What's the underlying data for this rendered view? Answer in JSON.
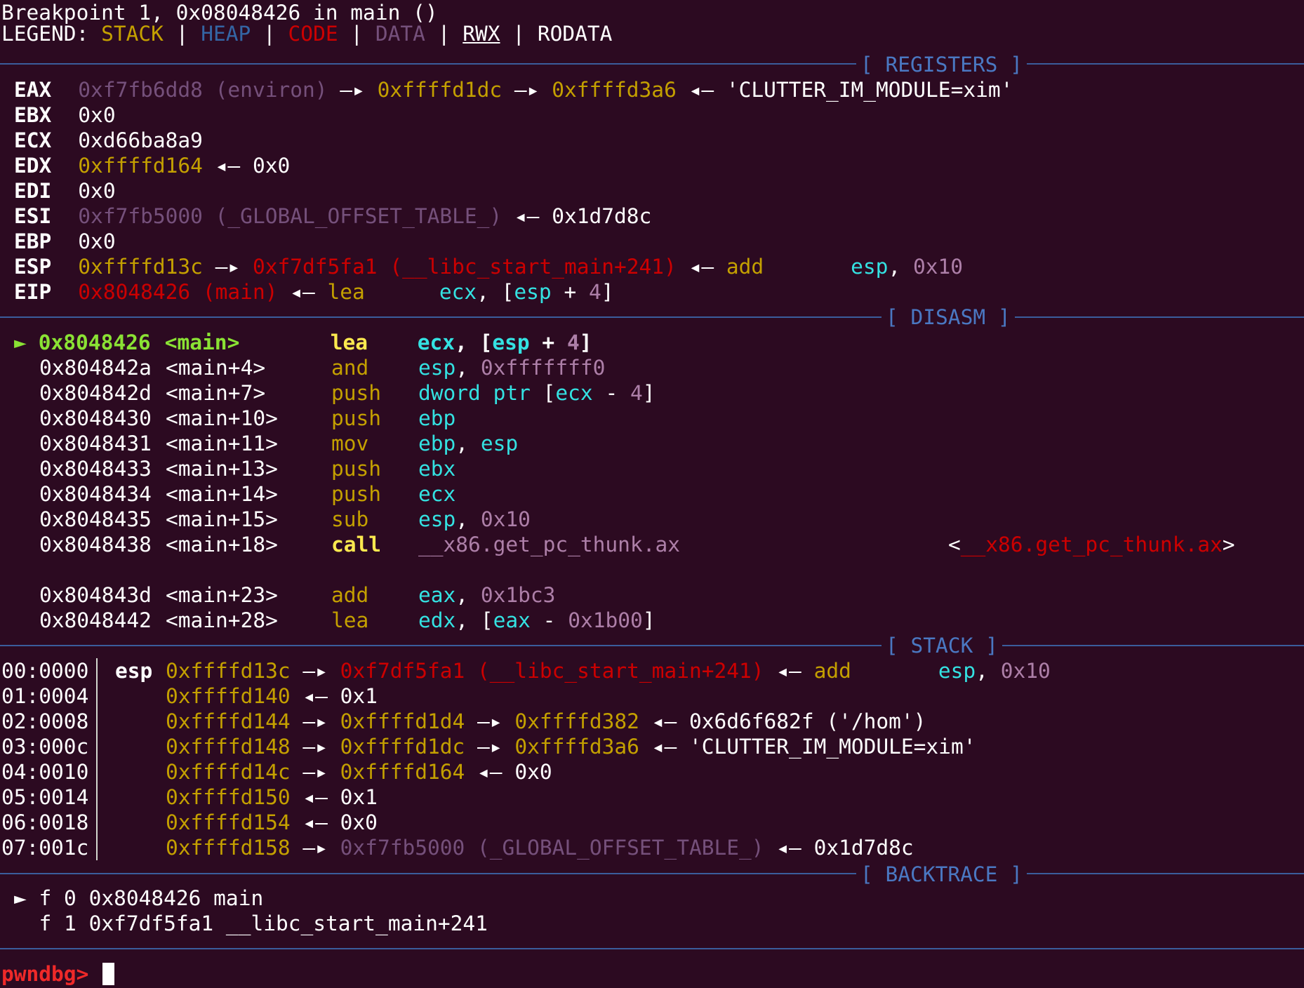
{
  "header": {
    "breakpoint_line": "Breakpoint 1, 0x08048426 in main ()",
    "legend_label": "LEGEND: ",
    "legend": {
      "stack": "STACK",
      "heap": "HEAP",
      "code": "CODE",
      "data": "DATA",
      "rwx": "RWX",
      "rodata": "RODATA",
      "sep": " | "
    }
  },
  "sections": {
    "registers": "[ REGISTERS ]",
    "disasm": "[ DISASM ]",
    "stack": "[ STACK ]",
    "backtrace": "[ BACKTRACE ]"
  },
  "registers": {
    "eax": {
      "name": "EAX",
      "addr": "0xf7fb6dd8 (environ)",
      "a1": " —▸ ",
      "p1": "0xffffd1dc",
      "a2": " —▸ ",
      "p2": "0xffffd3a6",
      "a3": " ◂— ",
      "val": "'CLUTTER_IM_MODULE=xim'"
    },
    "ebx": {
      "name": "EBX",
      "val": "0x0"
    },
    "ecx": {
      "name": "ECX",
      "val": "0xd66ba8a9"
    },
    "edx": {
      "name": "EDX",
      "addr": "0xffffd164",
      "a1": " ◂— ",
      "val": "0x0"
    },
    "edi": {
      "name": "EDI",
      "val": "0x0"
    },
    "esi": {
      "name": "ESI",
      "addr": "0xf7fb5000 (_GLOBAL_OFFSET_TABLE_)",
      "a1": " ◂— ",
      "val": "0x1d7d8c"
    },
    "ebp": {
      "name": "EBP",
      "val": "0x0"
    },
    "esp": {
      "name": "ESP",
      "addr": "0xffffd13c",
      "a1": " —▸ ",
      "code": "0xf7df5fa1 (__libc_start_main+241)",
      "a2": " ◂— ",
      "ins": "add",
      "op1": "esp",
      "comma": ", ",
      "op2": "0x10"
    },
    "eip": {
      "name": "EIP",
      "code": "0x8048426 (main)",
      "a1": " ◂— ",
      "ins": "lea",
      "op1": "ecx",
      "rest1": ", [",
      "op2": "esp",
      "rest2": " + ",
      "op3": "4",
      "rest3": "]"
    }
  },
  "disasm": {
    "current_marker": "►",
    "rows": [
      {
        "addr": "0x8048426",
        "sym": "<main>",
        "ins": "lea",
        "a": "ecx",
        "b": ", [",
        "c": "esp",
        "d": " + ",
        "e": "4",
        "f": "]"
      },
      {
        "addr": "0x804842a",
        "sym": "<main+4>",
        "ins": "and",
        "a": "esp",
        "b": ", ",
        "e": "0xfffffff0"
      },
      {
        "addr": "0x804842d",
        "sym": "<main+7>",
        "ins": "push",
        "a": "dword ptr",
        "b": " [",
        "c": "ecx",
        "d": " - ",
        "e": "4",
        "f": "]"
      },
      {
        "addr": "0x8048430",
        "sym": "<main+10>",
        "ins": "push",
        "a": "ebp"
      },
      {
        "addr": "0x8048431",
        "sym": "<main+11>",
        "ins": "mov",
        "a": "ebp",
        "b": ", ",
        "c": "esp"
      },
      {
        "addr": "0x8048433",
        "sym": "<main+13>",
        "ins": "push",
        "a": "ebx"
      },
      {
        "addr": "0x8048434",
        "sym": "<main+14>",
        "ins": "push",
        "a": "ecx"
      },
      {
        "addr": "0x8048435",
        "sym": "<main+15>",
        "ins": "sub",
        "a": "esp",
        "b": ", ",
        "e": "0x10"
      },
      {
        "addr": "0x8048438",
        "sym": "<main+18>",
        "ins": "call",
        "a": "__x86.get_pc_thunk.ax",
        "target_l": "<",
        "target": "__x86.get_pc_thunk.ax",
        "target_r": ">"
      },
      {
        "addr": "0x804843d",
        "sym": "<main+23>",
        "ins": "add",
        "a": "eax",
        "b": ", ",
        "e": "0x1bc3"
      },
      {
        "addr": "0x8048442",
        "sym": "<main+28>",
        "ins": "lea",
        "a": "edx",
        "b": ", [",
        "c": "eax",
        "d": " - ",
        "e": "0x1b00",
        "f": "]"
      }
    ]
  },
  "stack": {
    "rows": [
      {
        "off": "00:0000",
        "reg": "esp",
        "addr": "0xffffd13c",
        "a1": " —▸ ",
        "code": "0xf7df5fa1 (__libc_start_main+241)",
        "a2": " ◂— ",
        "ins": "add",
        "op1": "esp",
        "comma": ", ",
        "op2": "0x10"
      },
      {
        "off": "01:0004",
        "addr": "0xffffd140",
        "a1": " ◂— ",
        "val": "0x1"
      },
      {
        "off": "02:0008",
        "addr": "0xffffd144",
        "a1": " —▸ ",
        "p1": "0xffffd1d4",
        "a2": " —▸ ",
        "p2": "0xffffd382",
        "a3": " ◂— ",
        "val": "0x6d6f682f ('/hom')"
      },
      {
        "off": "03:000c",
        "addr": "0xffffd148",
        "a1": " —▸ ",
        "p1": "0xffffd1dc",
        "a2": " —▸ ",
        "p2": "0xffffd3a6",
        "a3": " ◂— ",
        "val": "'CLUTTER_IM_MODULE=xim'"
      },
      {
        "off": "04:0010",
        "addr": "0xffffd14c",
        "a1": " —▸ ",
        "p1": "0xffffd164",
        "a2": " ◂— ",
        "val": "0x0"
      },
      {
        "off": "05:0014",
        "addr": "0xffffd150",
        "a1": " ◂— ",
        "val": "0x1"
      },
      {
        "off": "06:0018",
        "addr": "0xffffd154",
        "a1": " ◂— ",
        "val": "0x0"
      },
      {
        "off": "07:001c",
        "addr": "0xffffd158",
        "a1": " —▸ ",
        "data": "0xf7fb5000 (_GLOBAL_OFFSET_TABLE_)",
        "a2": " ◂— ",
        "val": "0x1d7d8c"
      }
    ]
  },
  "backtrace": {
    "rows": [
      {
        "marker": "►",
        "text": " f 0 0x8048426 main"
      },
      {
        "marker": " ",
        "text": " f 1 0xf7df5fa1 __libc_start_main+241"
      }
    ]
  },
  "prompt": "pwndbg> ",
  "colors": {
    "background": "#2c0a21",
    "stack": "#c4a000",
    "heap": "#3465a4",
    "code": "#cc0000",
    "data": "#75507b",
    "separator": "#3a5d9c",
    "instruction": "#c4a000",
    "register": "#34e2e2",
    "number": "#ad7fa8",
    "current": "#8ae234",
    "prompt": "#ef2929"
  }
}
